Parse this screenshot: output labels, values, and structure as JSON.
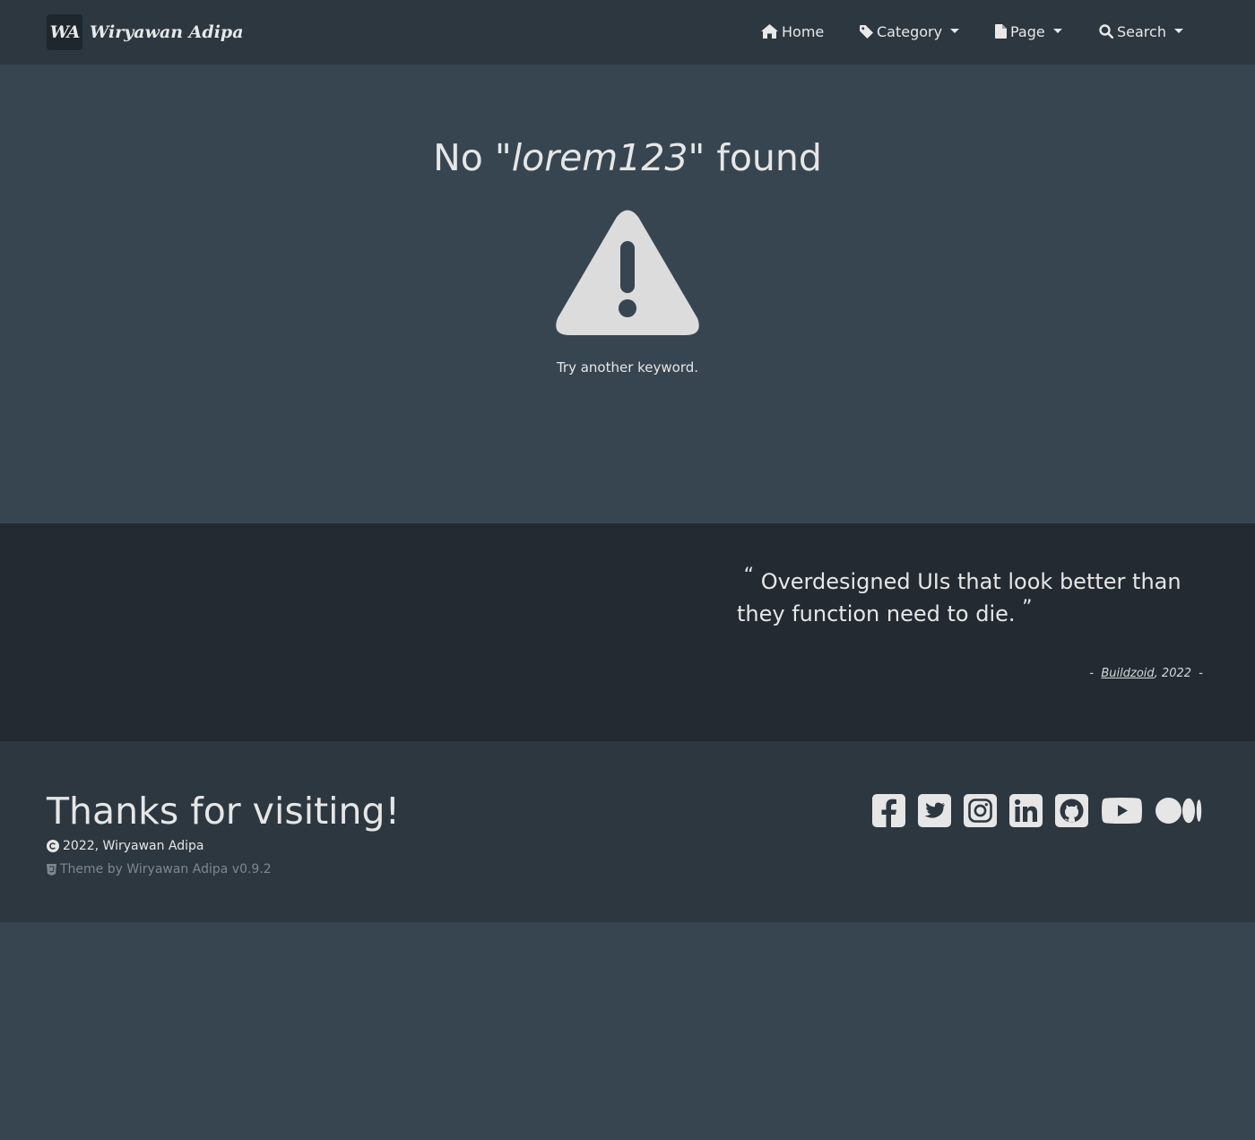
{
  "nav": {
    "logo_text": "WA",
    "brand": "Wiryawan Adipa",
    "items": [
      {
        "label": "Home",
        "icon": "home-icon",
        "dropdown": false
      },
      {
        "label": "Category",
        "icon": "tag-icon",
        "dropdown": true
      },
      {
        "label": "Page",
        "icon": "file-icon",
        "dropdown": true
      },
      {
        "label": "Search",
        "icon": "search-icon",
        "dropdown": true
      }
    ]
  },
  "result": {
    "prefix": "No \"",
    "keyword": "lorem123",
    "suffix": "\" found",
    "icon": "warning-triangle-icon",
    "hint": "Try another keyword."
  },
  "quote": {
    "open_mark": "“",
    "text": "Overdesigned UIs that look better than they function need to die.",
    "close_mark": "”",
    "dash_before": "-",
    "author": "Buildzoid",
    "year": ", 2022",
    "dash_after": "-"
  },
  "footer": {
    "thanks": "Thanks for visiting!",
    "copyright": "2022, Wiryawan Adipa",
    "theme_credit": "Theme by Wiryawan Adipa v0.9.2",
    "social_icons": [
      "facebook-icon",
      "twitter-icon",
      "instagram-icon",
      "linkedin-icon",
      "github-icon",
      "youtube-icon",
      "medium-icon"
    ]
  },
  "colors": {
    "page_bg": "#374550",
    "navbar_bg": "#2d3740",
    "quote_bg": "#232a32",
    "text": "#e6e6e6",
    "muted": "#7c8790"
  }
}
